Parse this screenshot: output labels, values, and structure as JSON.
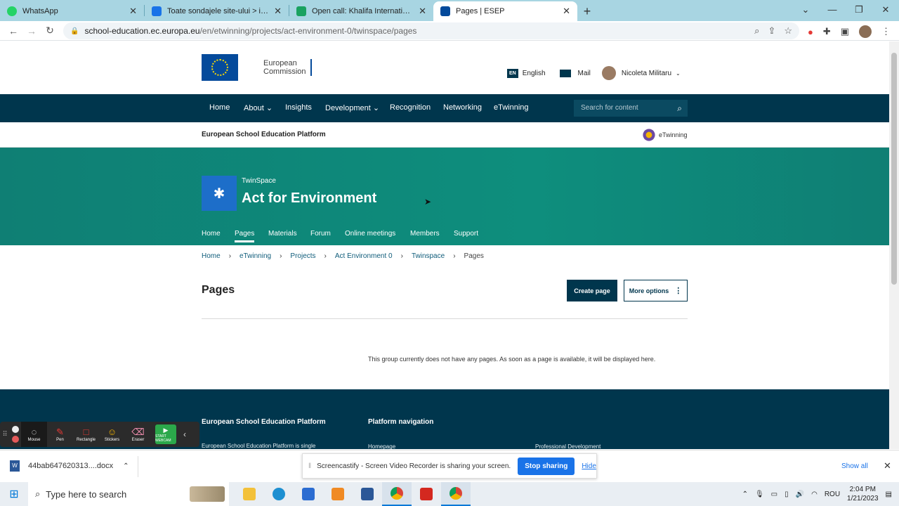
{
  "browser": {
    "tabs": [
      {
        "title": "WhatsApp",
        "color": "#25d366"
      },
      {
        "title": "Toate sondajele site-ului > iTeach",
        "color": "#1a73e8"
      },
      {
        "title": "Open call: Khalifa International A",
        "color": "#1aa260"
      },
      {
        "title": "Pages | ESEP",
        "color": "#044a9b"
      }
    ],
    "url_host": "school-education.ec.europa.eu",
    "url_path": "/en/etwinning/projects/act-environment-0/twinspace/pages"
  },
  "header": {
    "logo_line1": "European",
    "logo_line2": "Commission",
    "lang_code": "EN",
    "language": "English",
    "mail": "Mail",
    "user_name": "Nicoleta Militaru"
  },
  "main_nav": {
    "items": [
      "Home",
      "About",
      "Insights",
      "Development",
      "Recognition",
      "Networking",
      "eTwinning"
    ],
    "search_placeholder": "Search for content"
  },
  "platform": {
    "name": "European School Education Platform",
    "etwinning": "eTwinning"
  },
  "hero": {
    "kicker": "TwinSpace",
    "title": "Act for Environment",
    "subnav": [
      "Home",
      "Pages",
      "Materials",
      "Forum",
      "Online meetings",
      "Members",
      "Support"
    ],
    "active_subnav": "Pages"
  },
  "breadcrumb": [
    "Home",
    "eTwinning",
    "Projects",
    "Act Environment 0",
    "Twinspace",
    "Pages"
  ],
  "content": {
    "title": "Pages",
    "create_button": "Create page",
    "more_button": "More options",
    "empty_message": "This group currently does not have any pages. As soon as a page is available, it will be displayed here."
  },
  "footer": {
    "heading1": "European School Education Platform",
    "heading2": "Platform navigation",
    "text1": "European School Education Platform is single",
    "link1": "Homepage",
    "link2": "Professional Development"
  },
  "screencastify": {
    "tools": [
      "Mouse",
      "Pen",
      "Rectangle",
      "Stickers",
      "Eraser"
    ],
    "webcam": "START WEBCAM"
  },
  "downloads": {
    "file": "44bab647620313....docx",
    "share_text": "Screencastify - Screen Video Recorder is sharing your screen.",
    "stop": "Stop sharing",
    "hide": "Hide",
    "show_all": "Show all"
  },
  "taskbar": {
    "search_placeholder": "Type here to search",
    "lang": "ROU",
    "time": "2:04 PM",
    "date": "1/21/2023"
  }
}
